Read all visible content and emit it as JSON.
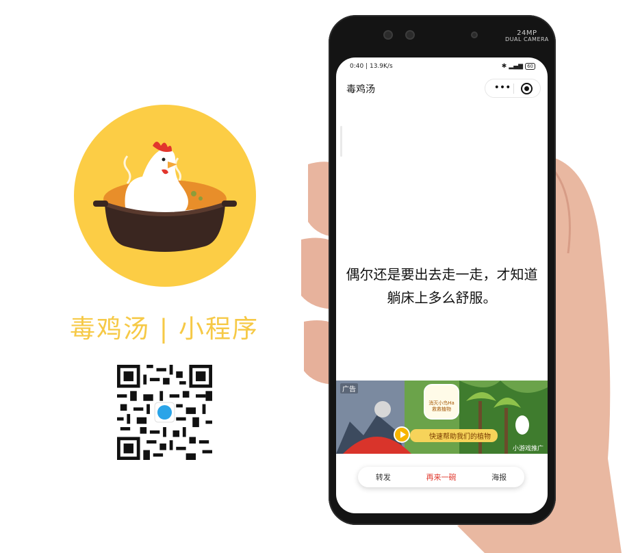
{
  "brand": {
    "title": "毒鸡汤 | 小程序",
    "logo_icon": "chicken-in-pot-icon",
    "qr_icon": "qr-code-icon",
    "colors": {
      "accent": "#fccd45",
      "title": "#f6c946",
      "primary_button": "#e0372c"
    }
  },
  "phone": {
    "camera_label_top": "24MP",
    "camera_label_bottom": "DUAL CAMERA",
    "statusbar": {
      "left": "0:40 | 13.9K/s",
      "right_icons": [
        "bluetooth-icon",
        "hd-icon",
        "signal-icon",
        "battery-icon"
      ],
      "battery": "60"
    },
    "navbar": {
      "title": "毒鸡汤",
      "more_icon": "•••",
      "close_icon": "close-miniprogram-icon"
    },
    "quote": "偶尔还是要出去走一走，才知道躺床上多么舒服。",
    "ad": {
      "tag": "广告",
      "app_name": "消灭小鸟Ha 救救植物",
      "slogan": "快速帮助我们的植物",
      "source": "小游戏推广"
    },
    "bottom_bar": {
      "share": "转发",
      "again": "再来一碗",
      "poster": "海报"
    }
  }
}
